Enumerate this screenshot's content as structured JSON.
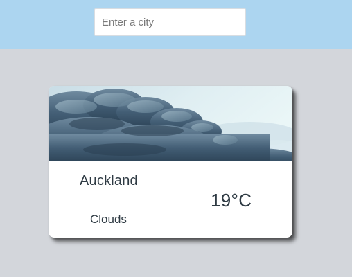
{
  "search": {
    "placeholder": "Enter a city",
    "value": ""
  },
  "weather_card": {
    "image": "storm-clouds-photo",
    "city": "Auckland",
    "temperature": "19°C",
    "condition": "Clouds"
  },
  "colors": {
    "topbar": "#acd5f0",
    "page_background": "#d3d6db",
    "card_background": "#ffffff",
    "text": "#2f3b44"
  }
}
